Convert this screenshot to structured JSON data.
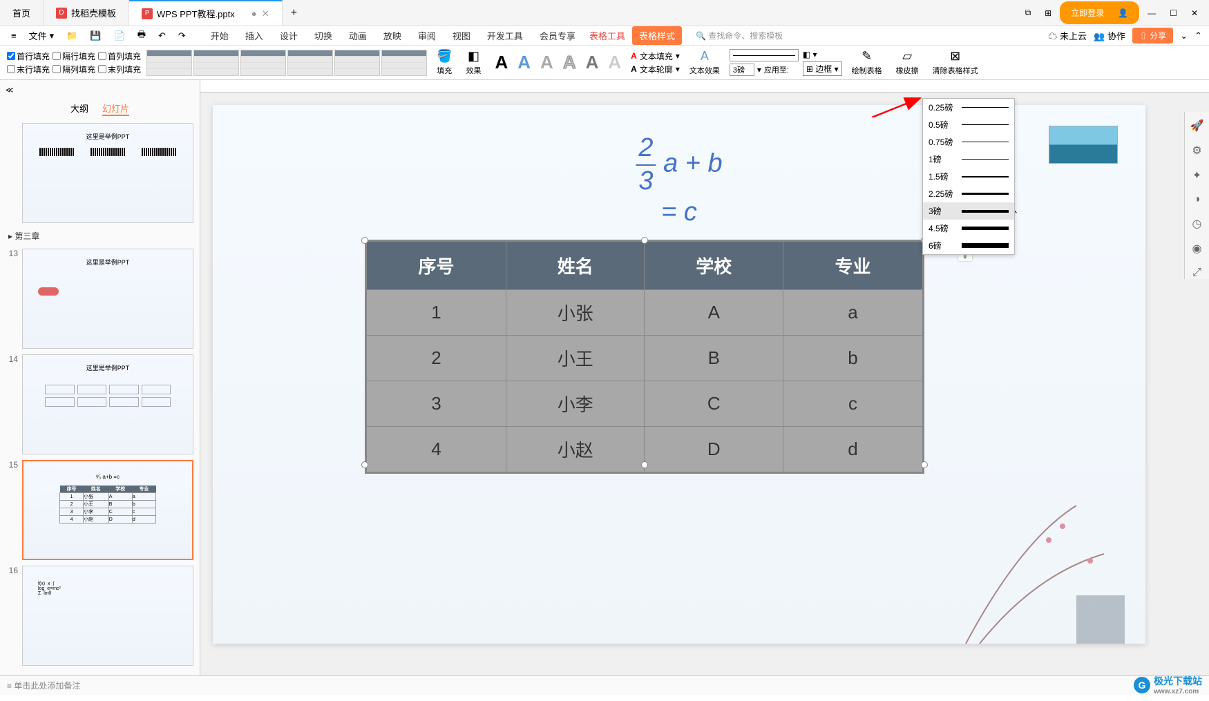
{
  "tabs": {
    "home": "首页",
    "template": "找稻壳模板",
    "file": "WPS PPT教程.pptx"
  },
  "titlebar": {
    "login": "立即登录"
  },
  "menu": {
    "file": "文件",
    "items": [
      "开始",
      "插入",
      "设计",
      "切换",
      "动画",
      "放映",
      "审阅",
      "视图",
      "开发工具",
      "会员专享"
    ],
    "table_tools": "表格工具",
    "table_style": "表格样式",
    "search": "查找命令、搜索模板",
    "not_cloud": "未上云",
    "collab": "协作",
    "share": "分享"
  },
  "ribbon": {
    "checks": {
      "first_row": "首行填充",
      "alt_row": "隔行填充",
      "first_col": "首列填充",
      "last_row": "末行填充",
      "alt_col": "隔列填充",
      "last_col": "末列填充"
    },
    "fill": "填充",
    "effect": "效果",
    "text_fill": "文本填充",
    "text_outline": "文本轮廓",
    "text_effect": "文本效果",
    "weight_value": "3磅",
    "apply_to": "应用至:",
    "border": "边框",
    "draw_table": "绘制表格",
    "eraser": "橡皮擦",
    "clear_style": "清除表格样式"
  },
  "panel": {
    "outline": "大纲",
    "slides": "幻灯片",
    "section": "第三章"
  },
  "thumbs": [
    "13",
    "14",
    "15",
    "16"
  ],
  "formula": {
    "num": "2",
    "den": "3",
    "rest1": "a + b",
    "rest2": "= c"
  },
  "table": {
    "headers": [
      "序号",
      "姓名",
      "学校",
      "专业"
    ],
    "rows": [
      [
        "1",
        "小张",
        "A",
        "a"
      ],
      [
        "2",
        "小王",
        "B",
        "b"
      ],
      [
        "3",
        "小李",
        "C",
        "c"
      ],
      [
        "4",
        "小赵",
        "D",
        "d"
      ]
    ]
  },
  "weights": [
    {
      "label": "0.25磅",
      "h": 0.5
    },
    {
      "label": "0.5磅",
      "h": 1
    },
    {
      "label": "0.75磅",
      "h": 1
    },
    {
      "label": "1磅",
      "h": 1.5
    },
    {
      "label": "1.5磅",
      "h": 2
    },
    {
      "label": "2.25磅",
      "h": 3
    },
    {
      "label": "3磅",
      "h": 4
    },
    {
      "label": "4.5磅",
      "h": 5
    },
    {
      "label": "6磅",
      "h": 7
    }
  ],
  "notes": "单击此处添加备注",
  "watermark": {
    "brand": "极光下载站",
    "url": "www.xz7.com"
  }
}
